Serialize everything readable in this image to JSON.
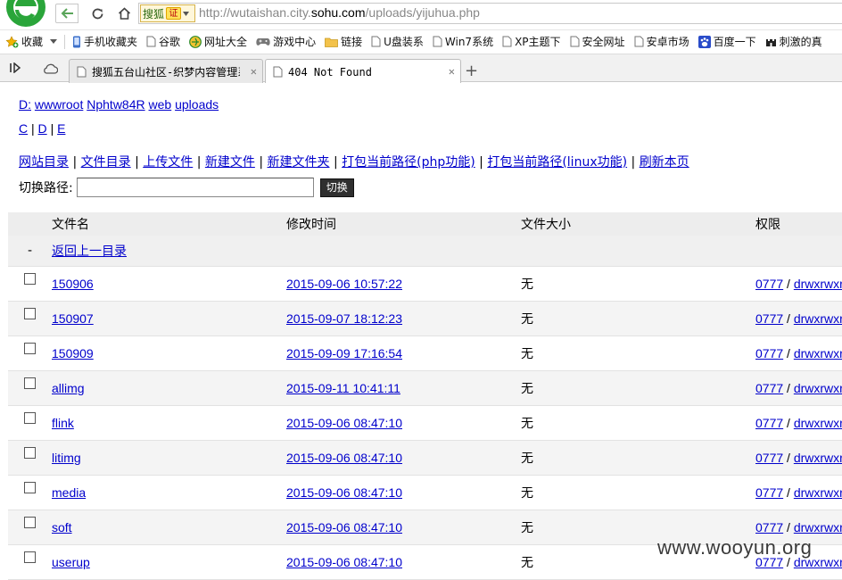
{
  "browser": {
    "url_prefix": "http://wutaishan.city.",
    "url_host": "sohu.com",
    "url_suffix": "/uploads/yijuhua.php",
    "search_engine": "搜狐",
    "cert_badge": "证",
    "bookmarks": [
      {
        "label": "收藏",
        "icon": "star-add-icon"
      },
      {
        "label": "手机收藏夹",
        "icon": "phone-icon"
      },
      {
        "label": "谷歌",
        "icon": "page-icon"
      },
      {
        "label": "网址大全",
        "icon": "globe-icon"
      },
      {
        "label": "游戏中心",
        "icon": "gamepad-icon"
      },
      {
        "label": "链接",
        "icon": "folder-icon"
      },
      {
        "label": "U盘装系",
        "icon": "page-icon"
      },
      {
        "label": "Win7系统",
        "icon": "page-icon"
      },
      {
        "label": "XP主题下",
        "icon": "page-icon"
      },
      {
        "label": "安全网址",
        "icon": "page-icon"
      },
      {
        "label": "安卓市场",
        "icon": "page-icon"
      },
      {
        "label": "百度一下",
        "icon": "baidu-paw-icon"
      },
      {
        "label": "刺激的真",
        "icon": "castle-icon"
      }
    ],
    "tabs": [
      {
        "title": "搜狐五台山社区-织梦内容管理系"
      },
      {
        "title": "404 Not Found"
      }
    ],
    "colors": {
      "logo_green": "#2aa53a",
      "link": "#0000cc",
      "header_bg": "#ededed"
    }
  },
  "page": {
    "path_segments": [
      "D:",
      "wwwroot",
      "Nphtw84R",
      "web",
      "uploads"
    ],
    "drives": [
      "C",
      "D",
      "E"
    ],
    "actions": [
      "网站目录",
      "文件目录",
      "上传文件",
      "新建文件",
      "新建文件夹",
      "打包当前路径(php功能)",
      "打包当前路径(linux功能)",
      "刷新本页"
    ],
    "switch_label": "切换路径:",
    "switch_input_value": "",
    "switch_button": "切换",
    "table": {
      "headers": [
        "文件名",
        "修改时间",
        "文件大小",
        "权限"
      ],
      "parent_dash": "-",
      "parent_link": "返回上一目录",
      "rows": [
        {
          "name": "150906",
          "time": "2015-09-06 10:57:22",
          "size": "无",
          "perm": "0777",
          "perm_str": "drwxrwxrwx"
        },
        {
          "name": "150907",
          "time": "2015-09-07 18:12:23",
          "size": "无",
          "perm": "0777",
          "perm_str": "drwxrwxrwx"
        },
        {
          "name": "150909",
          "time": "2015-09-09 17:16:54",
          "size": "无",
          "perm": "0777",
          "perm_str": "drwxrwxrwx"
        },
        {
          "name": "allimg",
          "time": "2015-09-11 10:41:11",
          "size": "无",
          "perm": "0777",
          "perm_str": "drwxrwxrwx"
        },
        {
          "name": "flink",
          "time": "2015-09-06 08:47:10",
          "size": "无",
          "perm": "0777",
          "perm_str": "drwxrwxrwx"
        },
        {
          "name": "litimg",
          "time": "2015-09-06 08:47:10",
          "size": "无",
          "perm": "0777",
          "perm_str": "drwxrwxrwx"
        },
        {
          "name": "media",
          "time": "2015-09-06 08:47:10",
          "size": "无",
          "perm": "0777",
          "perm_str": "drwxrwxrwx"
        },
        {
          "name": "soft",
          "time": "2015-09-06 08:47:10",
          "size": "无",
          "perm": "0777",
          "perm_str": "drwxrwxrwx"
        },
        {
          "name": "userup",
          "time": "2015-09-06 08:47:10",
          "size": "无",
          "perm": "0777",
          "perm_str": "drwxrwxrwx"
        }
      ]
    },
    "watermark": "www.wooyun.org"
  }
}
